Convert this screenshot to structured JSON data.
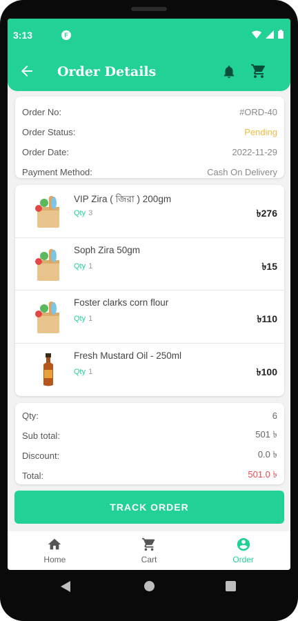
{
  "status_bar": {
    "time": "3:13",
    "app_badge": "F"
  },
  "app_bar": {
    "title": "Order Details"
  },
  "order_info": [
    {
      "label": "Order No:",
      "value": "#ORD-40"
    },
    {
      "label": "Order Status:",
      "value": "Pending"
    },
    {
      "label": "Order Date:",
      "value": "2022-11-29"
    },
    {
      "label": "Payment Method:",
      "value": "Cash On Delivery"
    }
  ],
  "items": [
    {
      "name": "VIP Zira ( জিরা ) 200gm",
      "qty_label": "Qty",
      "qty": "3",
      "price": "৳276",
      "icon": "grocery-bag-icon"
    },
    {
      "name": "Soph Zira 50gm",
      "qty_label": "Qty",
      "qty": "1",
      "price": "৳15",
      "icon": "grocery-bag-icon"
    },
    {
      "name": "Foster clarks corn flour",
      "qty_label": "Qty",
      "qty": "1",
      "price": "৳110",
      "icon": "grocery-bag-icon"
    },
    {
      "name": "Fresh Mustard Oil - 250ml",
      "qty_label": "Qty",
      "qty": "1",
      "price": "৳100",
      "icon": "oil-bottle-icon"
    }
  ],
  "summary": [
    {
      "label": "Qty:",
      "value": "6"
    },
    {
      "label": "Sub total:",
      "value": "501 ৳"
    },
    {
      "label": "Discount:",
      "value": "0.0 ৳"
    },
    {
      "label": "Total:",
      "value": "501.0 ৳"
    }
  ],
  "track_button": "TRACK ORDER",
  "bottom_nav": [
    {
      "label": "Home",
      "icon": "home-icon"
    },
    {
      "label": "Cart",
      "icon": "cart-icon"
    },
    {
      "label": "Order",
      "icon": "account-circle-icon"
    }
  ],
  "colors": {
    "accent": "#22d196",
    "pending": "#f4b942",
    "total": "#f2474e"
  }
}
